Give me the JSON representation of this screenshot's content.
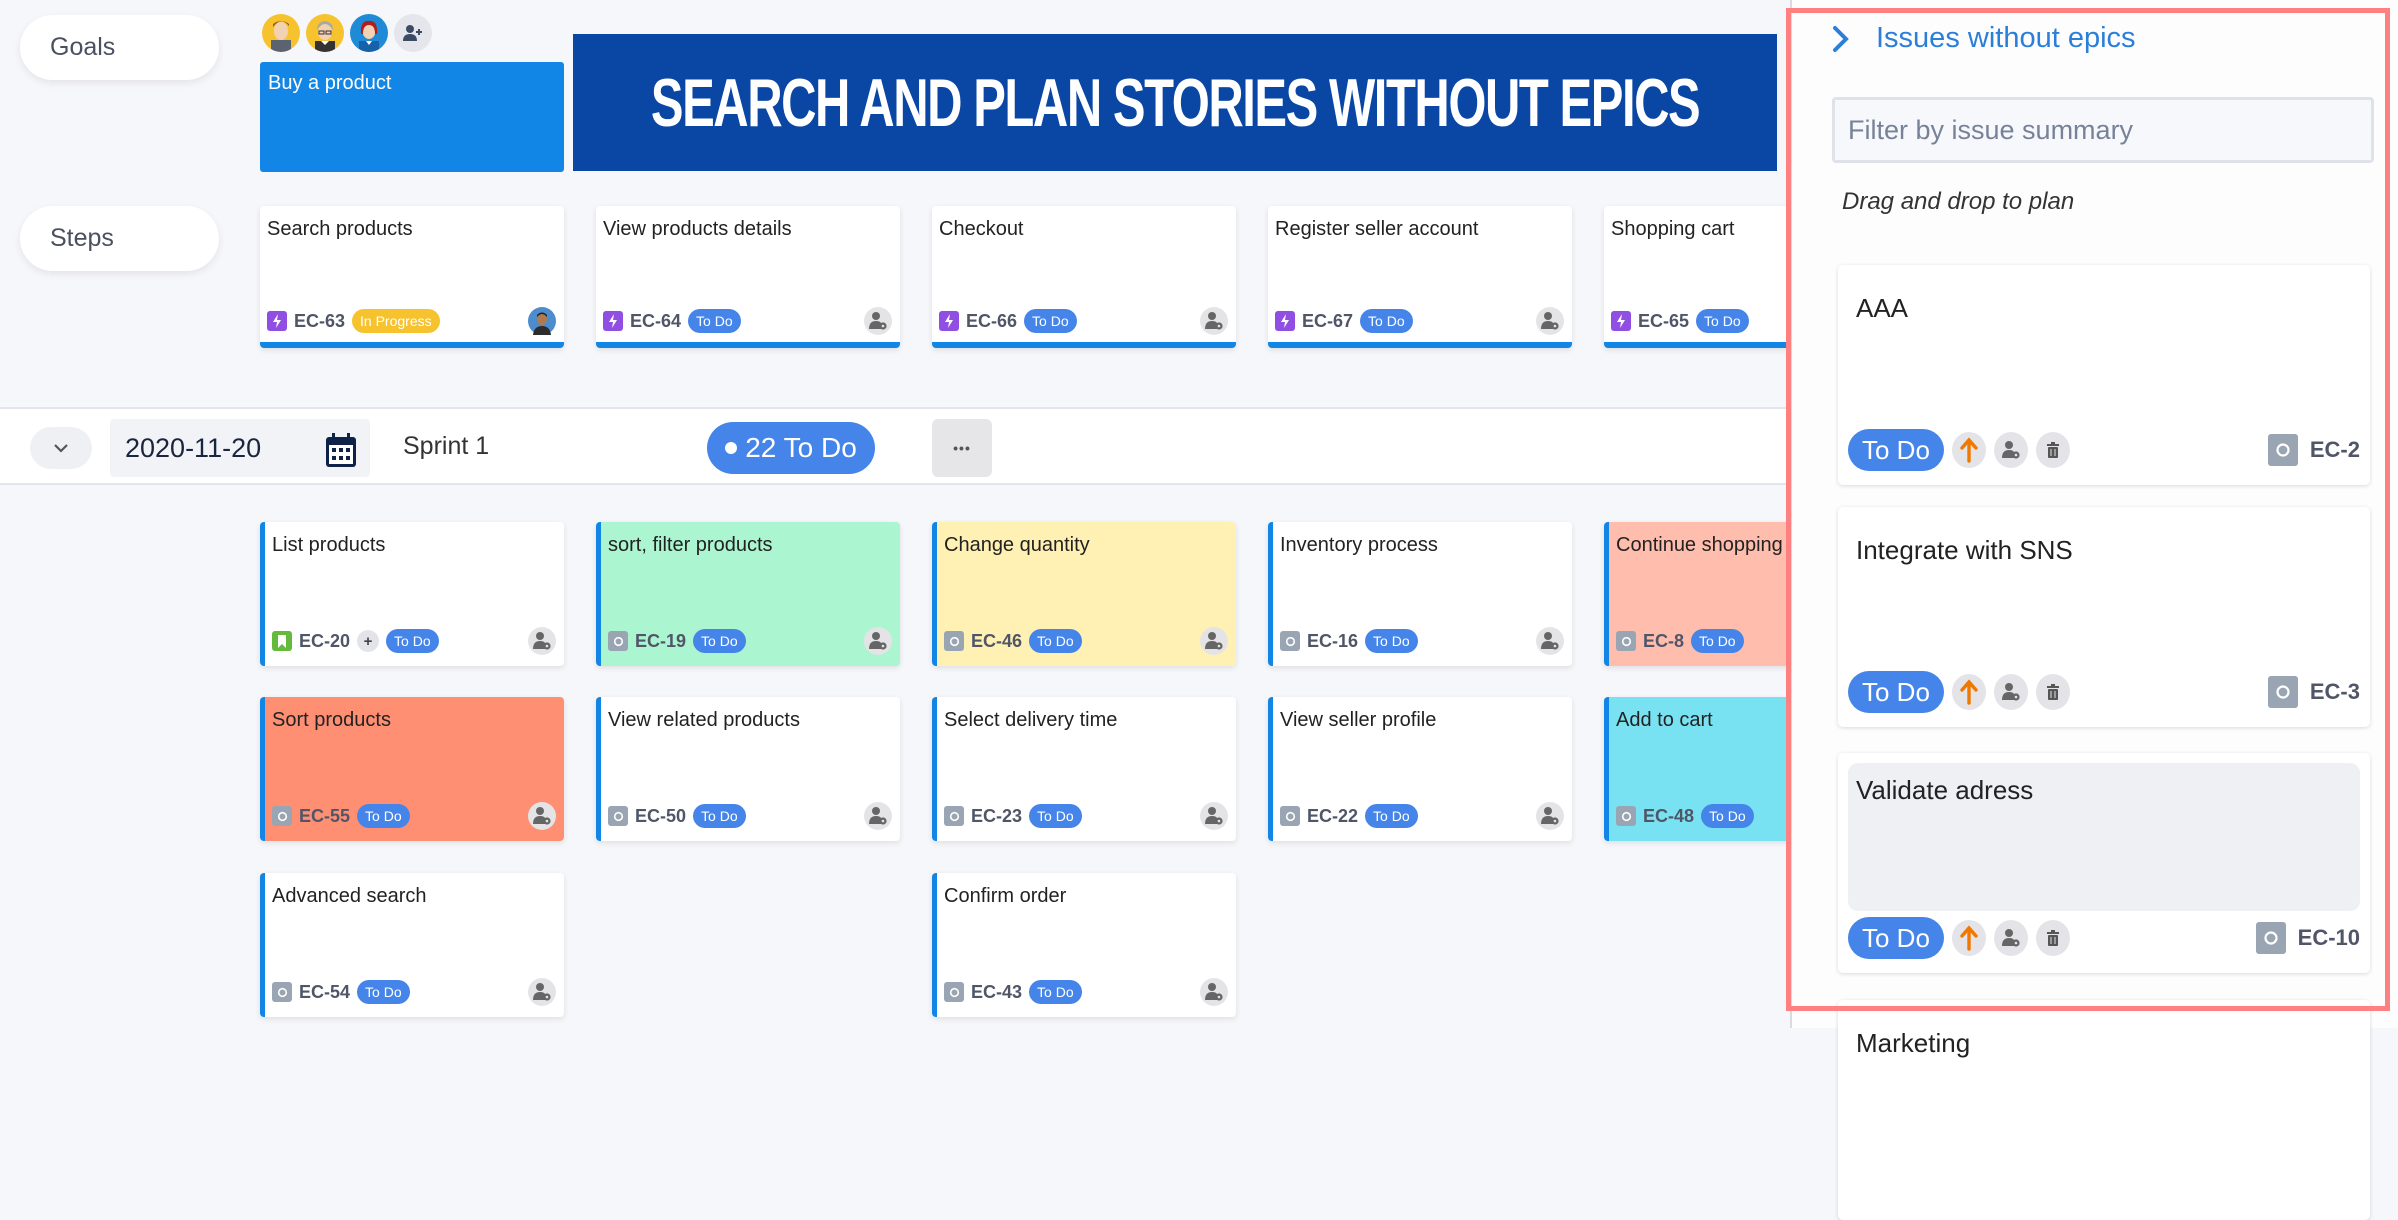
{
  "lanes": {
    "goals_label": "Goals",
    "steps_label": "Steps"
  },
  "avatars": [
    {
      "name": "user-avatar-1",
      "bg": "#f6c22e"
    },
    {
      "name": "user-avatar-2",
      "bg": "#f6c22e"
    },
    {
      "name": "user-avatar-3",
      "bg": "#1f8ad6"
    }
  ],
  "goal": {
    "title": "Buy a product"
  },
  "banner": {
    "text": "SEARCH AND PLAN STORIES WITHOUT EPICS"
  },
  "steps": [
    {
      "title": "Search products",
      "key": "EC-63",
      "status": "In Progress",
      "assignee": "photo"
    },
    {
      "title": "View products details",
      "key": "EC-64",
      "status": "To Do",
      "assignee": "unassigned"
    },
    {
      "title": "Checkout",
      "key": "EC-66",
      "status": "To Do",
      "assignee": "unassigned"
    },
    {
      "title": "Register seller account",
      "key": "EC-67",
      "status": "To Do",
      "assignee": "unassigned"
    },
    {
      "title": "Shopping cart",
      "key": "EC-65",
      "status": "To Do",
      "assignee": "none"
    }
  ],
  "sprint": {
    "date": "2020-11-20",
    "name": "Sprint 1",
    "todo_count_label": "22 To Do",
    "more_label": "•••"
  },
  "stories": [
    {
      "title": "List products",
      "key": "EC-20",
      "status": "To Do",
      "type": "story",
      "bg": "#ffffff",
      "plus": "+",
      "col": 0,
      "row": 0
    },
    {
      "title": "sort, filter products",
      "key": "EC-19",
      "status": "To Do",
      "type": "task",
      "bg": "#abf5d1",
      "col": 1,
      "row": 0
    },
    {
      "title": "Change quantity",
      "key": "EC-46",
      "status": "To Do",
      "type": "task",
      "bg": "#fff0b3",
      "col": 2,
      "row": 0
    },
    {
      "title": "Inventory process",
      "key": "EC-16",
      "status": "To Do",
      "type": "task",
      "bg": "#ffffff",
      "col": 3,
      "row": 0
    },
    {
      "title": "Continue shopping",
      "key": "EC-8",
      "status": "To Do",
      "type": "task",
      "bg": "#ffbdad",
      "col": 4,
      "row": 0,
      "noassignee": true
    },
    {
      "title": "Sort products",
      "key": "EC-55",
      "status": "To Do",
      "type": "task",
      "bg": "#ff8f73",
      "col": 0,
      "row": 1
    },
    {
      "title": "View related products",
      "key": "EC-50",
      "status": "To Do",
      "type": "task",
      "bg": "#ffffff",
      "col": 1,
      "row": 1
    },
    {
      "title": "Select delivery time",
      "key": "EC-23",
      "status": "To Do",
      "type": "task",
      "bg": "#ffffff",
      "col": 2,
      "row": 1
    },
    {
      "title": "View seller profile",
      "key": "EC-22",
      "status": "To Do",
      "type": "task",
      "bg": "#ffffff",
      "col": 3,
      "row": 1
    },
    {
      "title": "Add to cart",
      "key": "EC-48",
      "status": "To Do",
      "type": "task",
      "bg": "#79e2f2",
      "col": 4,
      "row": 1,
      "noassignee": true
    },
    {
      "title": "Advanced search",
      "key": "EC-54",
      "status": "To Do",
      "type": "task",
      "bg": "#ffffff",
      "col": 0,
      "row": 2
    },
    {
      "title": "Confirm order",
      "key": "EC-43",
      "status": "To Do",
      "type": "task",
      "bg": "#ffffff",
      "col": 2,
      "row": 2
    }
  ],
  "panel": {
    "title": "Issues without epics",
    "filter_placeholder": "Filter by issue summary",
    "filter_value": "",
    "hint": "Drag and drop to plan",
    "issues": [
      {
        "title": "AAA",
        "key": "EC-2",
        "status": "To Do",
        "highlighted": false
      },
      {
        "title": "Integrate with SNS",
        "key": "EC-3",
        "status": "To Do",
        "highlighted": false
      },
      {
        "title": "Validate adress",
        "key": "EC-10",
        "status": "To Do",
        "highlighted": true
      },
      {
        "title": "Marketing",
        "key": "",
        "status": "",
        "highlighted": false
      }
    ]
  },
  "colors": {
    "accent": "#1286e6",
    "status_todo": "#4584e8",
    "status_inprogress": "#f6c22e",
    "panel_title": "#2b7fd8",
    "highlight_frame": "#ff8080",
    "priority_high": "#f07800"
  }
}
